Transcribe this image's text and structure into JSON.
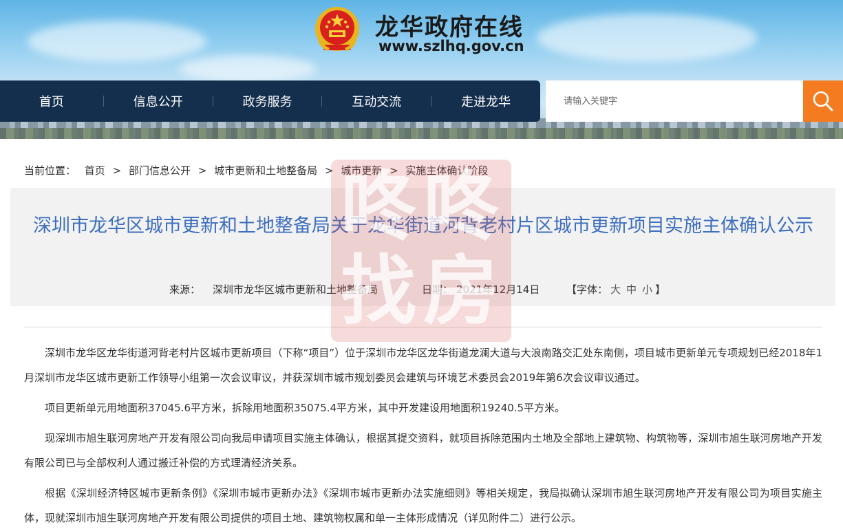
{
  "header": {
    "site_title": "龙华政府在线",
    "site_url": "www.szlhq.gov.cn"
  },
  "nav": {
    "items": [
      "首页",
      "信息公开",
      "政务服务",
      "互动交流",
      "走进龙华"
    ]
  },
  "search": {
    "placeholder": "请输入关键字",
    "icon": "search-icon"
  },
  "breadcrumb": {
    "prefix": "当前位置：",
    "items": [
      "首页",
      "部门信息公开",
      "城市更新和土地整备局",
      "城市更新",
      "实施主体确认阶段"
    ],
    "separator": ">"
  },
  "article": {
    "title": "深圳市龙华区城市更新和土地整备局关于龙华街道河背老村片区城市更新项目实施主体确认公示",
    "source_label": "来源：",
    "source_value": "深圳市龙华区城市更新和土地整备局",
    "date_label": "日期：",
    "date_value": "2021年12月14日",
    "font_label_open": "【字体：",
    "font_sizes": [
      "大",
      "中",
      "小"
    ],
    "font_label_close": "】",
    "paragraphs": [
      "深圳市龙华区龙华街道河背老村片区城市更新项目（下称“项目”）位于深圳市龙华区龙华街道龙澜大道与大浪南路交汇处东南侧，项目城市更新单元专项规划已经2018年1月深圳市龙华区城市更新工作领导小组第一次会议审议，并获深圳市城市规划委员会建筑与环境艺术委员会2019年第6次会议审议通过。",
      "项目更新单元用地面积37045.6平方米，拆除用地面积35075.4平方米，其中开发建设用地面积19240.5平方米。",
      "现深圳市旭生联河房地产开发有限公司向我局申请项目实施主体确认，根据其提交资料，就项目拆除范围内土地及全部地上建筑物、构筑物等，深圳市旭生联河房地产开发有限公司已与全部权利人通过搬迁补偿的方式理清经济关系。",
      "根据《深圳经济特区城市更新条例》《深圳市城市更新办法》《深圳市城市更新办法实施细则》等相关规定，我局拟确认深圳市旭生联河房地产开发有限公司为项目实施主体，现就深圳市旭生联河房地产开发有限公司提供的项目土地、建筑物权属和单一主体形成情况（详见附件二）进行公示。"
    ]
  },
  "watermark": {
    "chars": [
      "咚",
      "咚",
      "找",
      "房"
    ]
  },
  "colors": {
    "nav_bg": "#142f4d",
    "search_btn": "#f47b20",
    "title_blue": "#3e6fbd",
    "panel_bg": "#f2f2f2"
  }
}
